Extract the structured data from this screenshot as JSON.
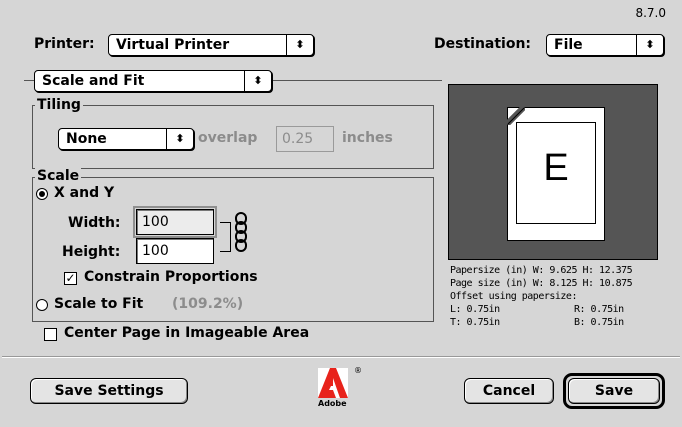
{
  "version": "8.7.0",
  "printer": {
    "label": "Printer:",
    "value": "Virtual Printer"
  },
  "destination": {
    "label": "Destination:",
    "value": "File"
  },
  "panel": {
    "value": "Scale and Fit"
  },
  "tiling": {
    "title": "Tiling",
    "mode": "None",
    "overlap_label": "overlap",
    "overlap_value": "0.25",
    "units": "inches"
  },
  "scale": {
    "title": "Scale",
    "xy_label": "X and Y",
    "width_label": "Width:",
    "width_value": "100",
    "height_label": "Height:",
    "height_value": "100",
    "constrain_label": "Constrain Proportions",
    "fit_label": "Scale to Fit",
    "fit_value": "(109.2%)"
  },
  "center_label": "Center Page in Imageable Area",
  "preview": {
    "letter": "E",
    "lines": [
      "Papersize (in) W: 9.625 H: 12.375",
      "Page size  (in) W: 8.125 H: 10.875",
      "Offset using papersize:"
    ],
    "offsets": {
      "l": "L: 0.75in",
      "r": "R: 0.75in",
      "t": "T: 0.75in",
      "b": "B: 0.75in"
    }
  },
  "buttons": {
    "save_settings": "Save Settings",
    "cancel": "Cancel",
    "save": "Save"
  },
  "logo_text": "Adobe",
  "icons": {
    "popup": "up-down-arrows-icon",
    "link": "chain-link-icon",
    "logo": "adobe-logo-icon"
  }
}
